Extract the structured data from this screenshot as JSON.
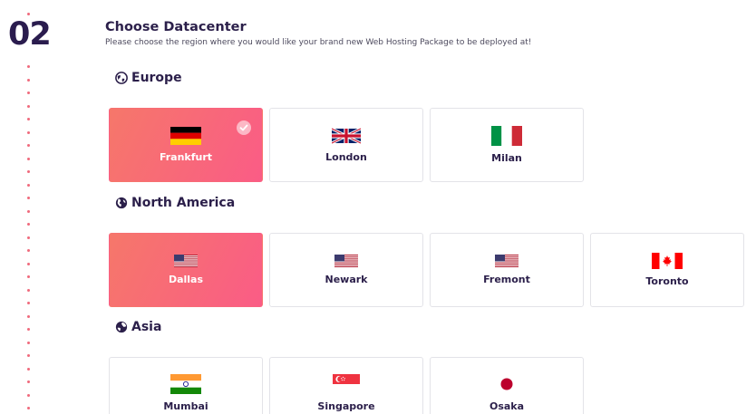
{
  "step": {
    "number": "02"
  },
  "header": {
    "title": "Choose Datacenter",
    "subtitle": "Please choose the region where you would like your brand new Web Hosting Package to be deployed at!"
  },
  "regions": {
    "europe": {
      "name": "Europe",
      "icon": "globe-europe-icon"
    },
    "north_america": {
      "name": "North America",
      "icon": "globe-americas-icon"
    },
    "asia": {
      "name": "Asia",
      "icon": "globe-asia-icon"
    }
  },
  "datacenters": {
    "frankfurt": {
      "label": "Frankfurt",
      "flag": "germany-flag-icon",
      "selected": true
    },
    "london": {
      "label": "London",
      "flag": "uk-flag-icon",
      "selected": false
    },
    "milan": {
      "label": "Milan",
      "flag": "italy-flag-icon",
      "selected": false
    },
    "dallas": {
      "label": "Dallas",
      "flag": "us-flag-icon",
      "selected": true
    },
    "newark": {
      "label": "Newark",
      "flag": "us-flag-icon",
      "selected": false
    },
    "fremont": {
      "label": "Fremont",
      "flag": "us-flag-icon",
      "selected": false
    },
    "toronto": {
      "label": "Toronto",
      "flag": "canada-flag-icon",
      "selected": false
    },
    "mumbai": {
      "label": "Mumbai",
      "flag": "india-flag-icon",
      "selected": false
    },
    "singapore": {
      "label": "Singapore",
      "flag": "singapore-flag-icon",
      "selected": false
    },
    "osaka": {
      "label": "Osaka",
      "flag": "japan-flag-icon",
      "selected": false
    }
  },
  "colors": {
    "accent_start": "#f6776a",
    "accent_end": "#fa5c86",
    "text_dark": "#2b1f4a",
    "dot": "#f06a7c"
  }
}
